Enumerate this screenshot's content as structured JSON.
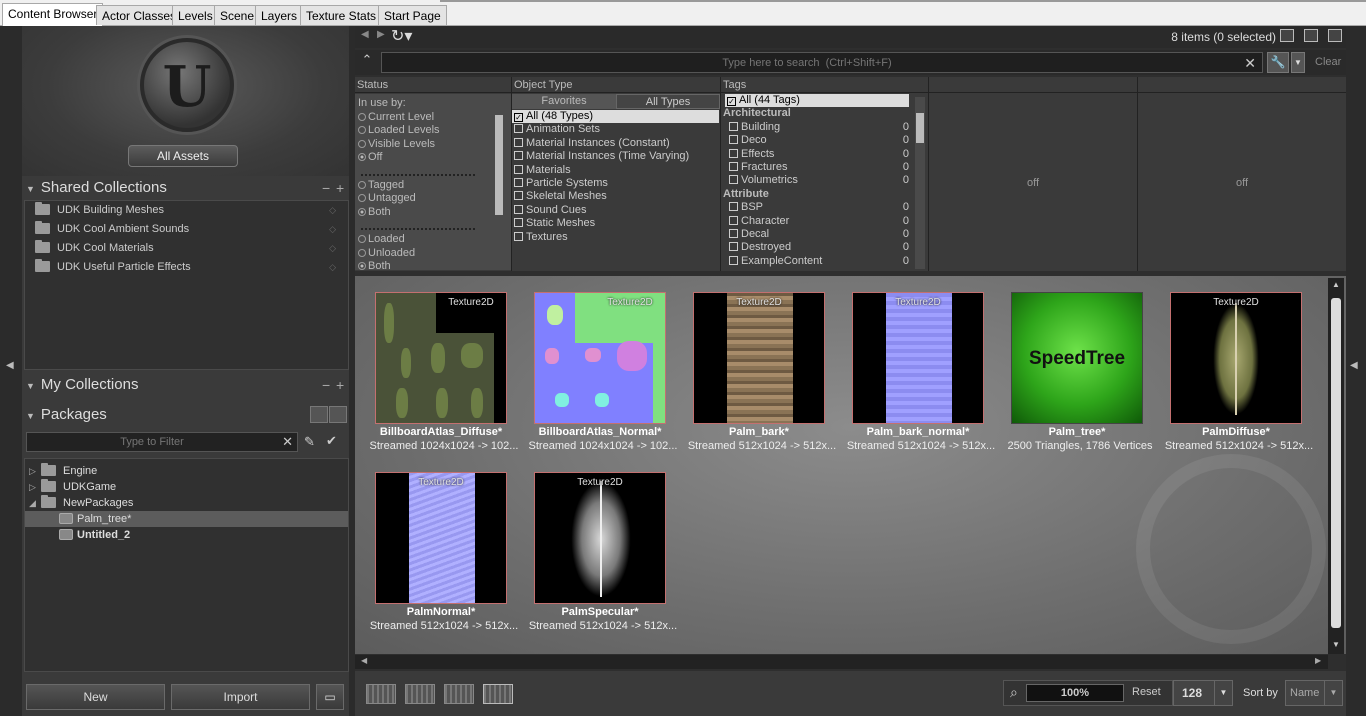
{
  "tabs": [
    "Content Browser",
    "Actor Classes",
    "Levels",
    "Scene",
    "Layers",
    "Texture Stats",
    "Start Page"
  ],
  "left": {
    "all_assets": "All Assets",
    "shared_collections": {
      "title": "Shared Collections",
      "items": [
        "UDK Building Meshes",
        "UDK Cool Ambient Sounds",
        "UDK Cool Materials",
        "UDK Useful Particle Effects"
      ]
    },
    "my_collections": {
      "title": "My Collections"
    },
    "packages": {
      "title": "Packages",
      "filter_placeholder": "Type to Filter",
      "tree": [
        {
          "label": "Engine"
        },
        {
          "label": "UDKGame"
        },
        {
          "label": "NewPackages"
        },
        {
          "label": "Palm_tree*"
        },
        {
          "label": "Untitled_2"
        }
      ]
    },
    "new_button": "New",
    "import_button": "Import"
  },
  "toolbar": {
    "item_count": "8 items (0 selected)",
    "search_placeholder": "Type here to search  (Ctrl+Shift+F)",
    "clear": "Clear"
  },
  "filters": {
    "status": {
      "title": "Status",
      "in_use_by": "In use by:",
      "use_options": [
        "Current Level",
        "Loaded Levels",
        "Visible Levels",
        "Off"
      ],
      "tag_options": [
        "Tagged",
        "Untagged",
        "Both"
      ],
      "load_options": [
        "Loaded",
        "Unloaded",
        "Both"
      ]
    },
    "object_type": {
      "title": "Object Type",
      "tab_favorites": "Favorites",
      "tab_all": "All Types",
      "items": [
        "All (48 Types)",
        "Animation Sets",
        "Material Instances (Constant)",
        "Material Instances (Time Varying)",
        "Materials",
        "Particle Systems",
        "Skeletal Meshes",
        "Sound Cues",
        "Static Meshes",
        "Textures"
      ]
    },
    "tags": {
      "title": "Tags",
      "all": "All (44 Tags)",
      "groups": [
        {
          "name": "Architectural",
          "items": [
            {
              "label": "Building",
              "count": "0"
            },
            {
              "label": "Deco",
              "count": "0"
            },
            {
              "label": "Effects",
              "count": "0"
            },
            {
              "label": "Fractures",
              "count": "0"
            },
            {
              "label": "Volumetrics",
              "count": "0"
            }
          ]
        },
        {
          "name": "Attribute",
          "items": [
            {
              "label": "BSP",
              "count": "0"
            },
            {
              "label": "Character",
              "count": "0"
            },
            {
              "label": "Decal",
              "count": "0"
            },
            {
              "label": "Destroyed",
              "count": "0"
            },
            {
              "label": "ExampleContent",
              "count": "0"
            }
          ]
        }
      ]
    },
    "off1": "off",
    "off2": "off"
  },
  "assets": [
    {
      "type": "Texture2D",
      "name": "BillboardAtlas_Diffuse*",
      "desc": "Streamed 1024x1024 -> 102..."
    },
    {
      "type": "Texture2D",
      "name": "BillboardAtlas_Normal*",
      "desc": "Streamed 1024x1024 -> 102..."
    },
    {
      "type": "Texture2D",
      "name": "Palm_bark*",
      "desc": "Streamed 512x1024 -> 512x..."
    },
    {
      "type": "Texture2D",
      "name": "Palm_bark_normal*",
      "desc": "Streamed 512x1024 -> 512x..."
    },
    {
      "type": "",
      "name": "Palm_tree*",
      "desc": "2500 Triangles, 1786 Vertices",
      "overlay": "SpeedTree"
    },
    {
      "type": "Texture2D",
      "name": "PalmDiffuse*",
      "desc": "Streamed 512x1024 -> 512x..."
    },
    {
      "type": "Texture2D",
      "name": "PalmNormal*",
      "desc": "Streamed 512x1024 -> 512x..."
    },
    {
      "type": "Texture2D",
      "name": "PalmSpecular*",
      "desc": "Streamed 512x1024 -> 512x..."
    }
  ],
  "bottom": {
    "zoom": "100%",
    "reset": "Reset",
    "thumb_size": "128",
    "sort_label": "Sort by",
    "sort_value": "Name"
  }
}
